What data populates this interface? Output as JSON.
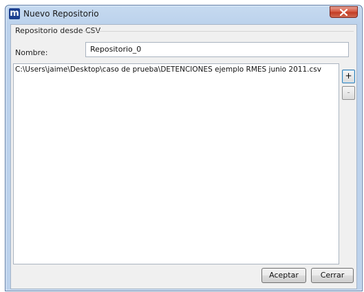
{
  "window": {
    "title": "Nuevo Repositorio",
    "app_icon_letter": "m"
  },
  "section": {
    "label": "Repositorio desde CSV"
  },
  "form": {
    "name_label": "Nombre:",
    "name_value": "Repositorio_0"
  },
  "files": {
    "items": [
      "C:\\Users\\jaime\\Desktop\\caso de prueba\\DETENCIONES ejemplo RMES junio 2011.csv"
    ],
    "add_label": "+",
    "remove_label": "-"
  },
  "buttons": {
    "accept": "Aceptar",
    "close": "Cerrar"
  },
  "colors": {
    "title_bar": "#bcd2ec",
    "close_button": "#c9452f",
    "client_background": "#f0f0f0"
  }
}
